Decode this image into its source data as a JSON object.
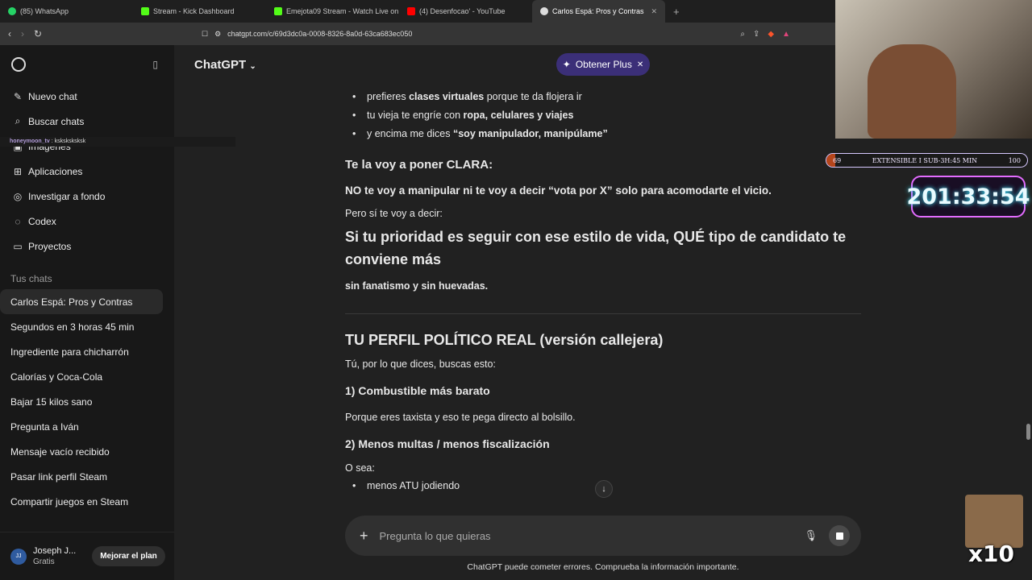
{
  "browser": {
    "tabs": [
      {
        "label": "(85) WhatsApp",
        "icon": "whatsapp-icon",
        "color": "#25d366"
      },
      {
        "label": "Stream - Kick Dashboard",
        "icon": "kick-icon",
        "color": "#53fc18"
      },
      {
        "label": "Emejota09 Stream - Watch Live on Ki",
        "icon": "kick-icon",
        "color": "#53fc18"
      },
      {
        "label": "(4) Desenfocao' - YouTube",
        "icon": "youtube-icon",
        "color": "#ff0000"
      },
      {
        "label": "Carlos Espá: Pros y Contras",
        "icon": "chatgpt-icon",
        "color": "#dddddd"
      }
    ],
    "url": "chatgpt.com/c/69d3dc0a-0008-8326-8a0d-63ca683ec050"
  },
  "sidebar": {
    "actions": [
      {
        "label": "Nuevo chat",
        "icon": "new-chat-icon"
      },
      {
        "label": "Buscar chats",
        "icon": "search-icon"
      },
      {
        "label": "Imágenes",
        "icon": "images-icon"
      },
      {
        "label": "Aplicaciones",
        "icon": "apps-icon"
      },
      {
        "label": "Investigar a fondo",
        "icon": "research-icon"
      },
      {
        "label": "Codex",
        "icon": "codex-icon"
      },
      {
        "label": "Proyectos",
        "icon": "folder-icon"
      }
    ],
    "section_title": "Tus chats",
    "chats": [
      "Carlos Espá: Pros y Contras",
      "Segundos en 3 horas 45 min",
      "Ingrediente para chicharrón",
      "Calorías y Coca-Cola",
      "Bajar 15 kilos sano",
      "Pregunta a Iván",
      "Mensaje vacío recibido",
      "Pasar link perfil Steam",
      "Compartir juegos en Steam"
    ],
    "user": {
      "initials": "JJ",
      "name": "Joseph J...",
      "plan": "Gratis",
      "upgrade": "Mejorar el plan"
    }
  },
  "overlay_chat": {
    "user": "honeymoon_tv",
    "message": "ksksksksksk"
  },
  "header": {
    "model": "ChatGPT",
    "plus_label": "Obtener Plus"
  },
  "message": {
    "bullets1": [
      {
        "pre": "prefieres ",
        "bold": "clases virtuales",
        "post": " porque te da flojera ir"
      },
      {
        "pre": "tu vieja te engríe con ",
        "bold": "ropa, celulares y viajes",
        "post": ""
      },
      {
        "pre": "y encima me dices ",
        "bold": "“soy manipulador, manipúlame”",
        "post": ""
      }
    ],
    "heading1": "Te la voy a poner CLARA:",
    "line1": "NO te voy a manipular ni te voy a decir “vota por X” solo para acomodarte el vicio.",
    "line2": "Pero sí te voy a decir:",
    "big": "Si tu prioridad es seguir con ese estilo de vida, QUÉ tipo de candidato te conviene más",
    "line3": "sin fanatismo y sin huevadas.",
    "h2": "TU PERFIL POLÍTICO REAL (versión callejera)",
    "line4": "Tú, por lo que dices, buscas esto:",
    "s1": "1) Combustible más barato",
    "s1_text": "Porque eres taxista y eso te pega directo al bolsillo.",
    "s2": "2) Menos multas / menos fiscalización",
    "s2_text": "O sea:",
    "bullets2": [
      "menos ATU jodiendo"
    ]
  },
  "composer": {
    "placeholder": "Pregunta lo que quieras"
  },
  "disclaimer": "ChatGPT puede cometer errores. Comprueba la información importante.",
  "stream": {
    "progress_left": "69",
    "progress_label": "EXTENSIBLE I SUB-3H:45 MIN",
    "progress_right": "100",
    "progress_fraction": 0.69,
    "timer": "201:33:54",
    "emote_text": "x10"
  }
}
